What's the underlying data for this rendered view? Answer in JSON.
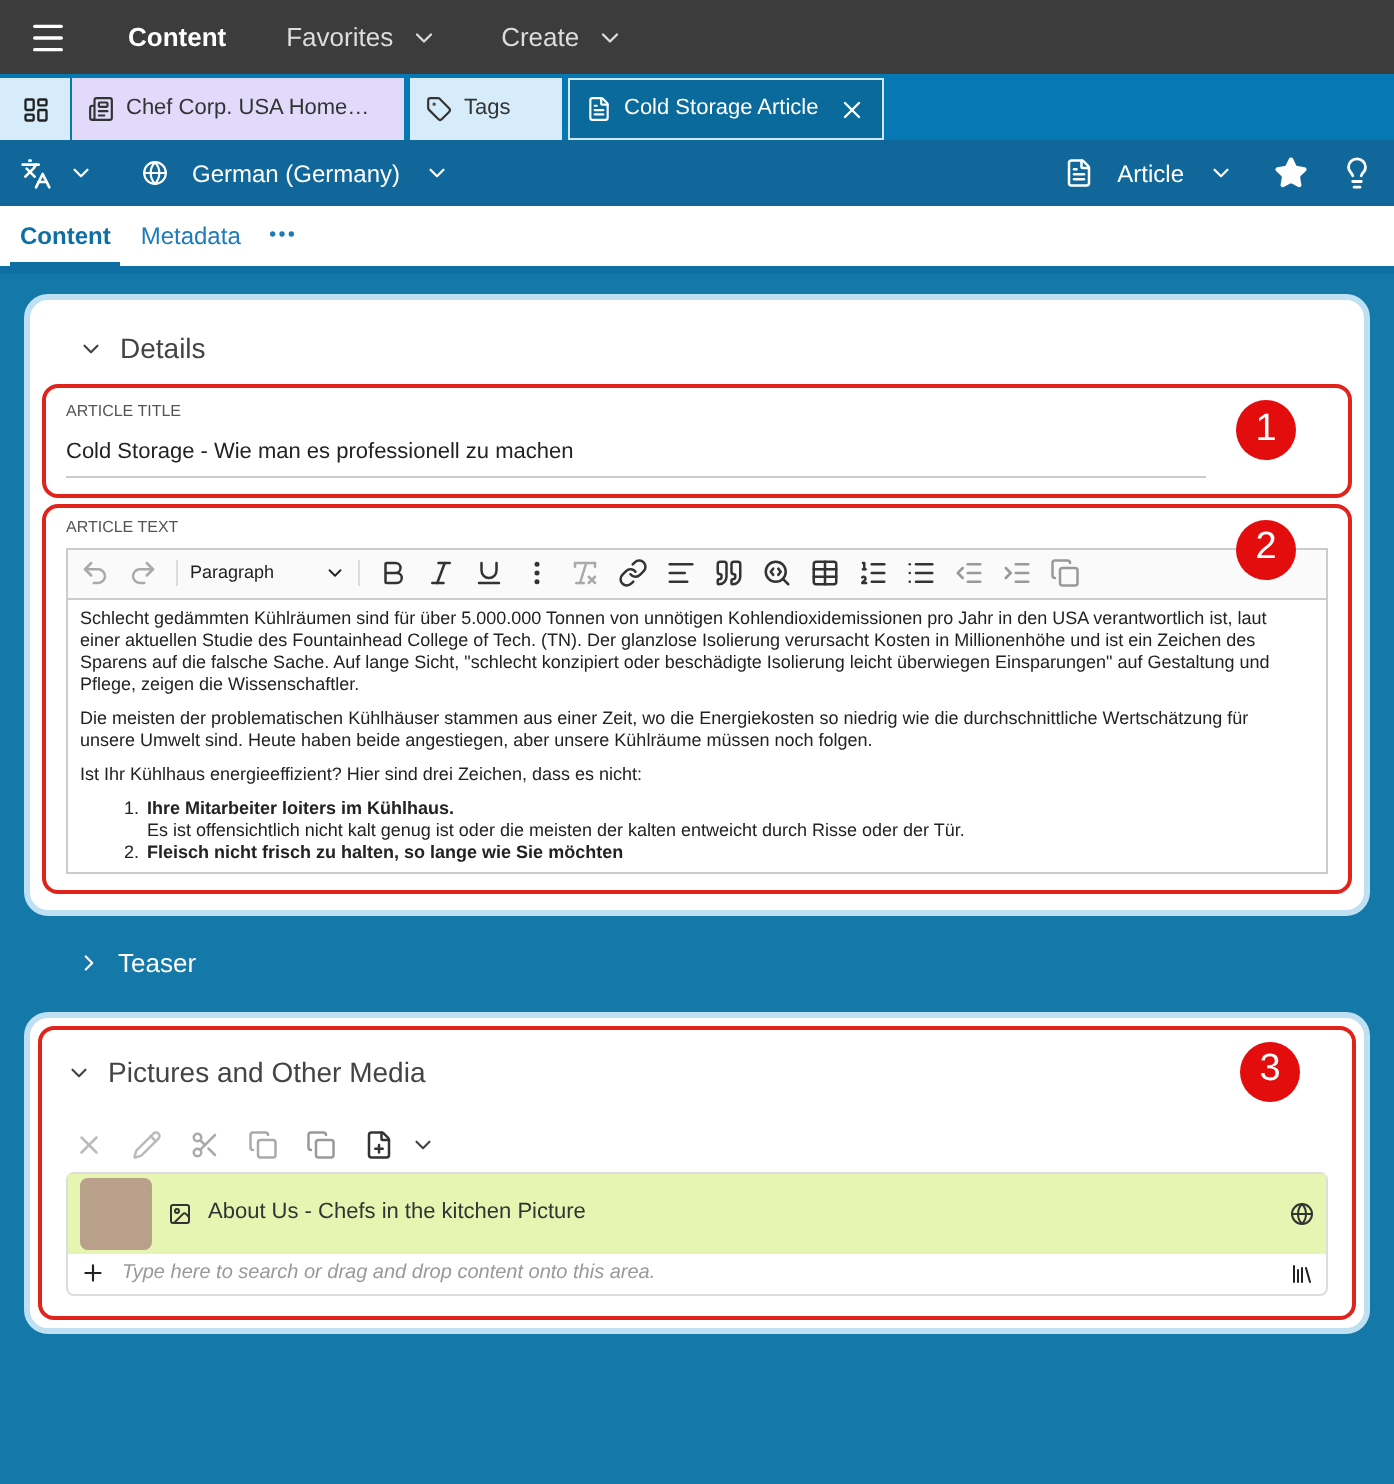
{
  "top_bar": {
    "title": "Content",
    "menus": [
      "Favorites",
      "Create"
    ]
  },
  "tabs": [
    {
      "label": "Chef Corp. USA Home…",
      "kind": "page",
      "selected": false,
      "closable": false
    },
    {
      "label": "Tags",
      "kind": "tag",
      "selected": false,
      "closable": false
    },
    {
      "label": "Cold Storage Article",
      "kind": "article",
      "selected": true,
      "closable": true
    }
  ],
  "toolbar": {
    "language": "German (Germany)",
    "doc_type": "Article"
  },
  "subtabs": [
    {
      "label": "Content",
      "selected": true
    },
    {
      "label": "Metadata",
      "selected": false
    }
  ],
  "details": {
    "heading": "Details",
    "expanded": true,
    "title_label": "ARTICLE TITLE",
    "title_value": "Cold Storage - Wie man es professionell zu machen",
    "text_label": "ARTICLE TEXT",
    "block_style": "Paragraph",
    "paragraphs": [
      "Schlecht gedämmten Kühlräumen sind für über 5.000.000 Tonnen von unnötigen Kohlendioxidemissionen pro Jahr in den USA verantwortlich ist, laut einer aktuellen Studie des Fountainhead College of Tech. (TN). Der glanzlose Isolierung verursacht Kosten in Millionenhöhe und ist ein Zeichen des Sparens auf die falsche Sache. Auf lange Sicht, \"schlecht konzipiert oder beschädigte Isolierung leicht überwiegen Einsparungen\" auf Gestaltung und Pflege, zeigen die Wissenschaftler.",
      "Die meisten der problematischen Kühlhäuser stammen aus einer Zeit, wo die Energiekosten so niedrig wie die durchschnittliche Wertschätzung für unsere Umwelt sind. Heute haben beide angestiegen, aber unsere Kühlräume müssen noch folgen.",
      "Ist Ihr Kühlhaus energieeffizient? Hier sind drei Zeichen, dass es nicht:"
    ],
    "list": [
      {
        "number": "1.",
        "title": "Ihre Mitarbeiter loiters im Kühlhaus.",
        "body": "Es ist offensichtlich nicht kalt genug ist oder die meisten der kalten entweicht durch Risse oder der Tür."
      },
      {
        "number": "2.",
        "title": "Fleisch nicht frisch zu halten, so lange wie Sie möchten"
      }
    ]
  },
  "teaser": {
    "heading": "Teaser",
    "expanded": false
  },
  "media": {
    "heading": "Pictures and Other Media",
    "expanded": true,
    "items": [
      {
        "title": "About Us - Chefs in the kitchen Picture"
      }
    ],
    "placeholder": "Type here to search or drag and drop content onto this area."
  },
  "callouts": [
    "1",
    "2",
    "3"
  ]
}
